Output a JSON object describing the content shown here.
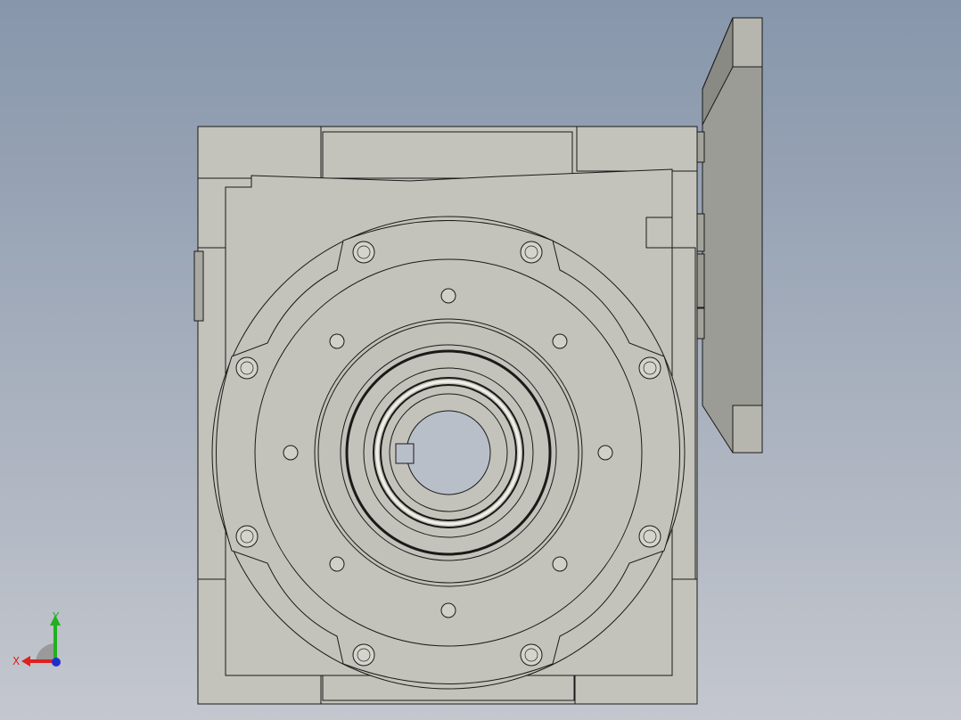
{
  "app": {
    "view": "front"
  },
  "viewport": {
    "background_top": "#8796ab",
    "background_bottom": "#c4c7ce"
  },
  "model": {
    "part_fill": "#c3c3bb",
    "part_fill_dark": "#a9a9a2",
    "edge_color": "#1a1a1a",
    "flange_fill": "#9c9c96",
    "bore_fill": "#b9bfc9"
  },
  "triad": {
    "x_label": "X",
    "y_label": "Y",
    "x_color": "#e02020",
    "y_color": "#20b020",
    "z_color": "#2030d0"
  }
}
